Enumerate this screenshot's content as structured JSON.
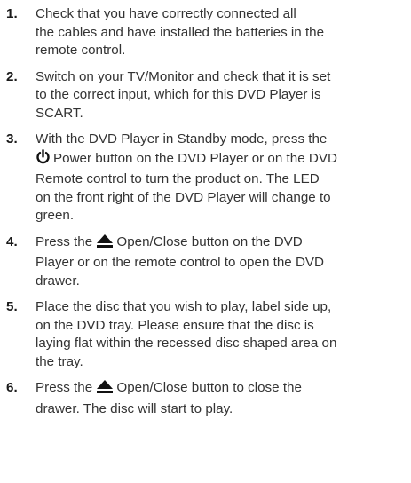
{
  "steps": [
    {
      "number": "1.",
      "lines": [
        "Check that you have correctly connected all",
        "the cables and have installed the batteries in the",
        "remote control."
      ]
    },
    {
      "number": "2.",
      "lines": [
        "Switch on your TV/Monitor and check that it is set",
        "to the correct input, which for this DVD Player is",
        "SCART."
      ]
    },
    {
      "number": "3.",
      "icon": "power-icon",
      "first_line_after_icon": "Power button on the DVD Player or on the DVD",
      "lines": [
        "With the DVD Player in Standby mode, press the",
        "Remote control to turn the product on. The LED",
        "on the front right of the DVD Player will change to",
        "green."
      ]
    },
    {
      "number": "4.",
      "icon": "eject-icon",
      "before_icon": "Press the",
      "after_icon": "Open/Close button on the DVD",
      "lines": [
        "Player or on the remote control to open the DVD",
        "drawer."
      ]
    },
    {
      "number": "5.",
      "lines": [
        "Place the disc that you wish to play, label side up,",
        "on the DVD tray. Please ensure that the disc is",
        "laying flat within the recessed disc shaped area on",
        "the tray."
      ]
    },
    {
      "number": "6.",
      "icon": "eject-icon",
      "before_icon": "Press the",
      "after_icon": "Open/Close button to close the",
      "lines": [
        "drawer. The disc will start to play."
      ]
    }
  ]
}
